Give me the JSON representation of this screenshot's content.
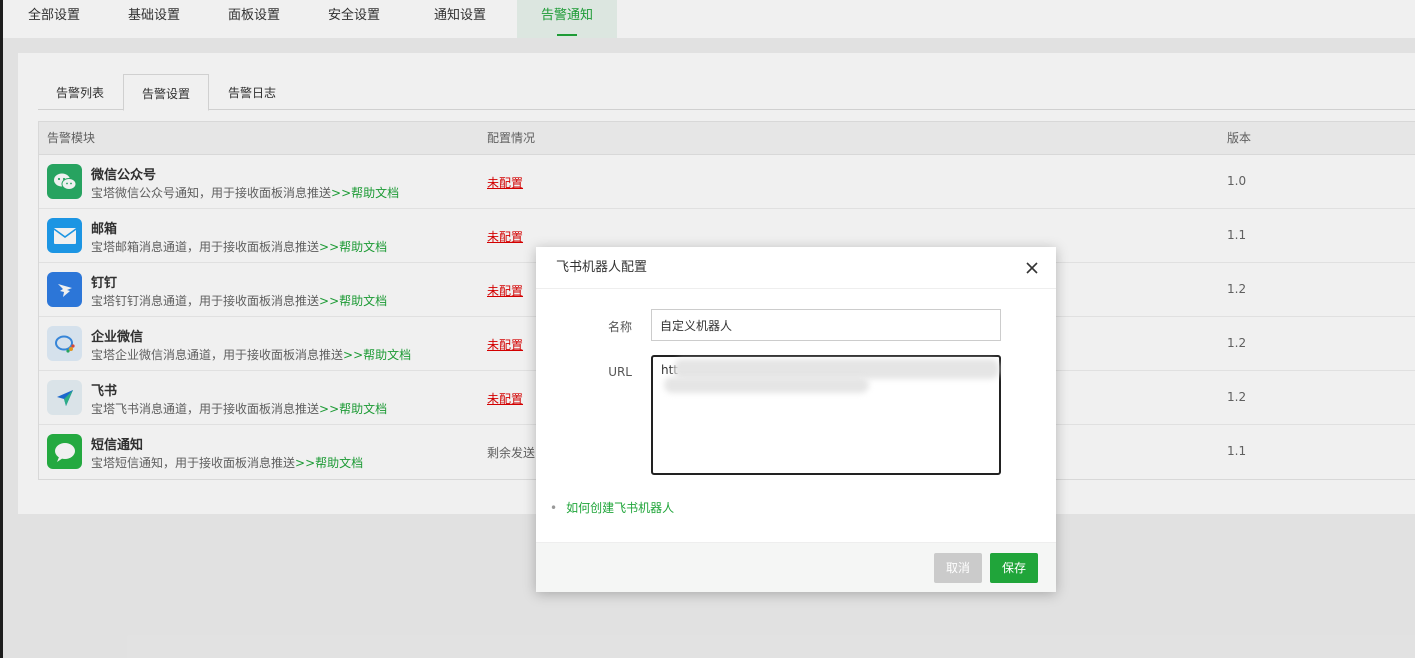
{
  "top_tabs": [
    "全部设置",
    "基础设置",
    "面板设置",
    "安全设置",
    "通知设置",
    "告警通知"
  ],
  "sub_tabs": [
    "告警列表",
    "告警设置",
    "告警日志"
  ],
  "table": {
    "headers": {
      "module": "告警模块",
      "config": "配置情况",
      "version": "版本"
    },
    "rows": [
      {
        "title": "微信公众号",
        "desc": "宝塔微信公众号通知，用于接收面板消息推送",
        "help": ">>帮助文档",
        "config": "未配置",
        "version": "1.0",
        "icon": "wechat-icon",
        "color": "#2aae67"
      },
      {
        "title": "邮箱",
        "desc": "宝塔邮箱消息通道，用于接收面板消息推送",
        "help": ">>帮助文档",
        "config": "未配置",
        "version": "1.1",
        "icon": "mail-icon",
        "color": "#1e9ff2"
      },
      {
        "title": "钉钉",
        "desc": "宝塔钉钉消息通道，用于接收面板消息推送",
        "help": ">>帮助文档",
        "config": "未配置",
        "version": "1.2",
        "icon": "dingtalk-icon",
        "color": "#2f7ee6"
      },
      {
        "title": "企业微信",
        "desc": "宝塔企业微信消息通道，用于接收面板消息推送",
        "help": ">>帮助文档",
        "config": "未配置",
        "version": "1.2",
        "icon": "wecom-icon",
        "color": "#e3f0fb"
      },
      {
        "title": "飞书",
        "desc": "宝塔飞书消息通道，用于接收面板消息推送",
        "help": ">>帮助文档",
        "config": "未配置",
        "version": "1.2",
        "icon": "feishu-icon",
        "color": "#e8f2f7"
      },
      {
        "title": "短信通知",
        "desc": "宝塔短信通知，用于接收面板消息推送",
        "help": ">>帮助文档",
        "config": "剩余发送",
        "version": "1.1",
        "icon": "sms-icon",
        "color": "#27b445"
      }
    ]
  },
  "dialog": {
    "title": "飞书机器人配置",
    "name_label": "名称",
    "name_value": "自定义机器人",
    "url_label": "URL",
    "url_value": "htt",
    "howto_link": "如何创建飞书机器人",
    "cancel_label": "取消",
    "save_label": "保存"
  }
}
